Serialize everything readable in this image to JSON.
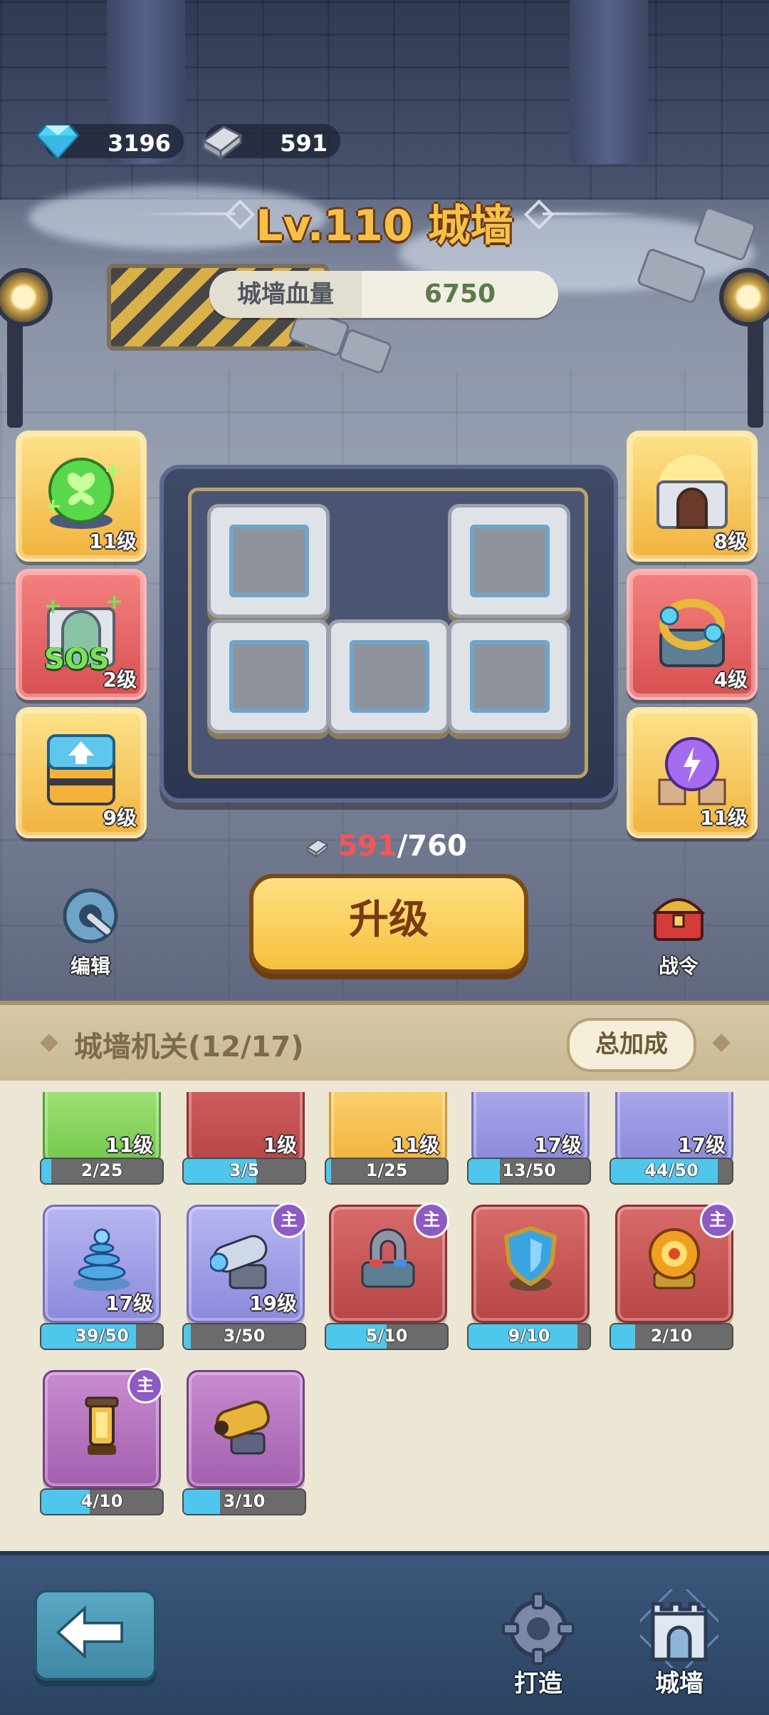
{
  "currency": {
    "gems": "3196",
    "steel": "591"
  },
  "wall": {
    "title": "Lv.110 城墙",
    "hp_label": "城墙血量",
    "hp_value": "6750"
  },
  "left_cards": [
    {
      "level": "11级",
      "icon": "butterfly-orb-icon"
    },
    {
      "level": "2级",
      "icon": "sos-gate-icon",
      "text": "SOS"
    },
    {
      "level": "9级",
      "icon": "upgrade-box-icon"
    }
  ],
  "right_cards": [
    {
      "level": "8级",
      "icon": "golden-gate-icon"
    },
    {
      "level": "4级",
      "icon": "crystal-ring-icon"
    },
    {
      "level": "11级",
      "icon": "purple-orb-icon"
    }
  ],
  "upgrade": {
    "have": "591",
    "need": "/760",
    "button": "升级"
  },
  "edit_label": "编辑",
  "battle_pass_label": "战令",
  "mechanisms": {
    "title": "城墙机关(12/17)",
    "total_bonus": "总加成",
    "items": [
      {
        "level": "11级",
        "progress": "2/25",
        "fill": 0.08,
        "color": "green"
      },
      {
        "level": "1级",
        "progress": "3/5",
        "fill": 0.6,
        "color": "red"
      },
      {
        "level": "11级",
        "progress": "1/25",
        "fill": 0.04,
        "color": "gold"
      },
      {
        "level": "17级",
        "progress": "13/50",
        "fill": 0.26,
        "color": "blue"
      },
      {
        "level": "17级",
        "progress": "44/50",
        "fill": 0.88,
        "color": "blue"
      },
      {
        "level": "17级",
        "progress": "39/50",
        "fill": 0.78,
        "color": "blue",
        "icon": "tower-spire-icon"
      },
      {
        "level": "19级",
        "progress": "3/50",
        "fill": 0.06,
        "color": "blue",
        "icon": "cannon-icon",
        "badge": "主"
      },
      {
        "level": "",
        "progress": "5/10",
        "fill": 0.5,
        "color": "red",
        "icon": "magnet-icon",
        "badge": "主"
      },
      {
        "level": "",
        "progress": "9/10",
        "fill": 0.9,
        "color": "red",
        "icon": "shield-icon"
      },
      {
        "level": "",
        "progress": "2/10",
        "fill": 0.2,
        "color": "red",
        "icon": "fire-orb-icon",
        "badge": "主"
      },
      {
        "level": "",
        "progress": "4/10",
        "fill": 0.4,
        "color": "purple",
        "icon": "lantern-icon",
        "badge": "主"
      },
      {
        "level": "",
        "progress": "3/10",
        "fill": 0.3,
        "color": "purple",
        "icon": "mortar-icon"
      }
    ]
  },
  "nav": {
    "forge": "打造",
    "wall": "城墙"
  }
}
